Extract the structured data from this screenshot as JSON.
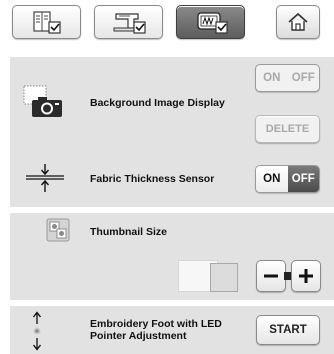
{
  "tabs": [
    {
      "name": "settings-page-1"
    },
    {
      "name": "settings-page-2"
    },
    {
      "name": "embroidery-settings"
    }
  ],
  "home": {
    "icon": "home-icon"
  },
  "background_image": {
    "label": "Background Image Display",
    "on_label": "ON",
    "off_label": "OFF",
    "delete_label": "DELETE",
    "enabled": false
  },
  "fabric_sensor": {
    "label": "Fabric Thickness Sensor",
    "on_label": "ON",
    "off_label": "OFF",
    "selected": "OFF"
  },
  "thumbnail": {
    "label": "Thumbnail Size"
  },
  "embroidery_foot": {
    "label_line1": "Embroidery Foot with LED",
    "label_line2": "Pointer Adjustment",
    "start_label": "START"
  }
}
